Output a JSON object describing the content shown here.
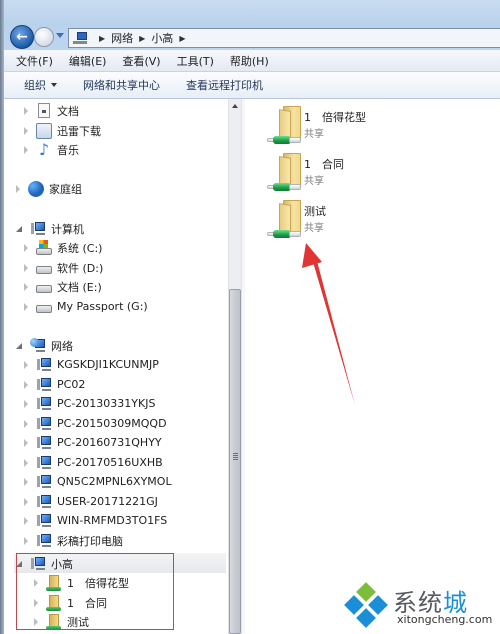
{
  "address": {
    "segments": [
      "网络",
      "小高"
    ]
  },
  "menu": [
    "文件(F)",
    "编辑(E)",
    "查看(V)",
    "工具(T)",
    "帮助(H)"
  ],
  "toolbar": {
    "organize": "组织",
    "network_center": "网络和共享中心",
    "remote_printers": "查看远程打印机"
  },
  "tree": {
    "libraries": [
      {
        "label": "文档",
        "icon": "document-icon"
      },
      {
        "label": "迅雷下载",
        "icon": "download-folder-icon"
      },
      {
        "label": "音乐",
        "icon": "music-icon"
      }
    ],
    "homegroup": "家庭组",
    "computer": {
      "label": "计算机",
      "drives": [
        {
          "label": "系统 (C:)",
          "icon": "system-drive-icon"
        },
        {
          "label": "软件 (D:)",
          "icon": "drive-icon"
        },
        {
          "label": "文档 (E:)",
          "icon": "drive-icon"
        },
        {
          "label": "My Passport (G:)",
          "icon": "drive-icon"
        }
      ]
    },
    "network": {
      "label": "网络",
      "hosts": [
        "KGSKDJI1KCUNMJP",
        "PC02",
        "PC-20130331YKJS",
        "PC-20150309MQQD",
        "PC-20160731QHYY",
        "PC-20170516UXHB",
        "QN5C2MPNL6XYMOL",
        "USER-20171221GJ",
        "WIN-RMFMD3TO1FS",
        "彩稿打印电脑"
      ],
      "selected_host": {
        "label": "小高",
        "shares": [
          "1　倍得花型",
          "1　合同",
          "测试"
        ]
      }
    }
  },
  "content": {
    "items": [
      {
        "name": "1　倍得花型",
        "type": "共享"
      },
      {
        "name": "1　合同",
        "type": "共享"
      },
      {
        "name": "测试",
        "type": "共享"
      }
    ]
  },
  "annotation": {
    "color": "#e03535",
    "highlight_color": "#c0474a"
  },
  "watermark": {
    "brand_a": "系统",
    "brand_b": "城",
    "url": "xitongcheng.com"
  }
}
